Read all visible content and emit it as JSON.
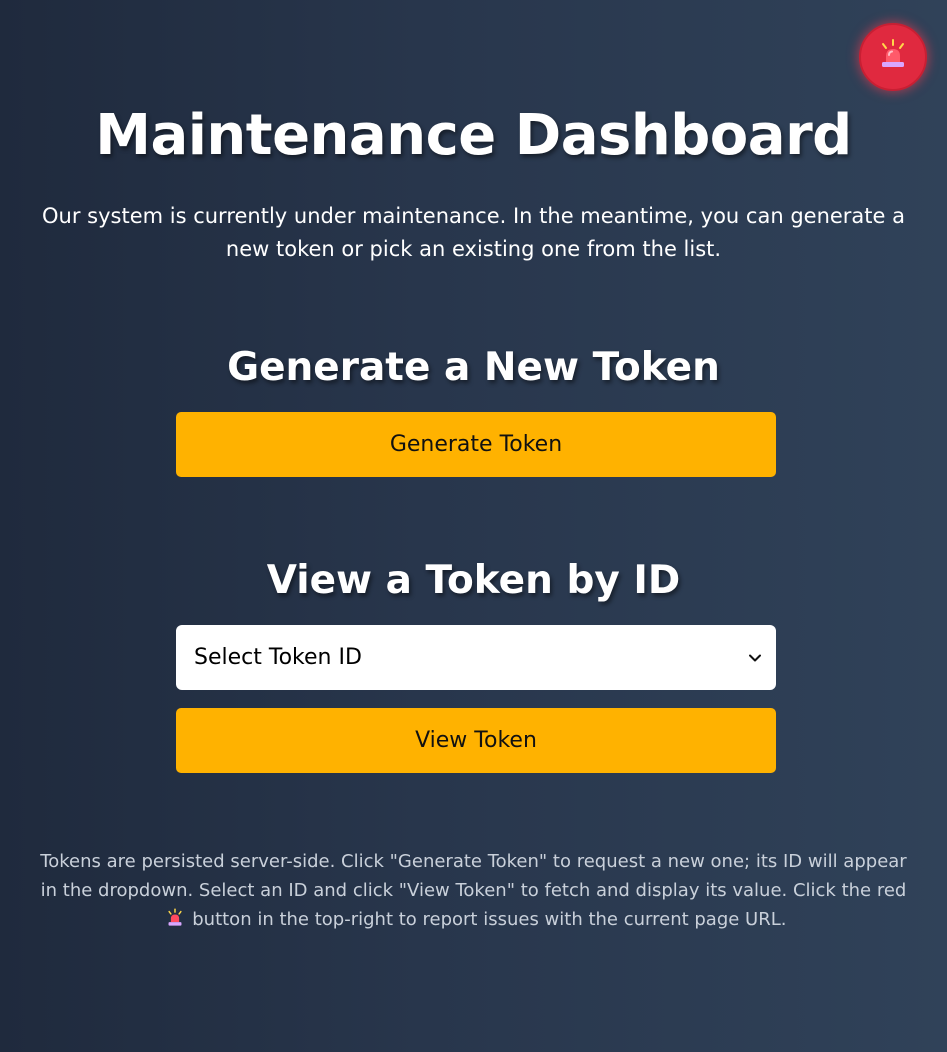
{
  "header": {
    "title": "Maintenance Dashboard",
    "intro": "Our system is currently under maintenance. In the meantime, you can generate a new token or pick an existing one from the list."
  },
  "report_button": {
    "icon": "siren-icon",
    "color": "#e0293f"
  },
  "generate_section": {
    "heading": "Generate a New Token",
    "button_label": "Generate Token"
  },
  "view_section": {
    "heading": "View a Token by ID",
    "select_value": "Select Token ID",
    "button_label": "View Token"
  },
  "footnote": {
    "text_before_icon": "Tokens are persisted server-side. Click \"Generate Token\" to request a new one; its ID will appear in the dropdown. Select an ID and click \"View Token\" to fetch and display its value. Click the red",
    "text_after_icon": "button in the top-right to report issues with the current page URL.",
    "icon": "siren-icon"
  },
  "colors": {
    "accent": "#ffb200",
    "alarm": "#e0293f",
    "background_start": "#1f2a3d",
    "background_end": "#304259"
  }
}
